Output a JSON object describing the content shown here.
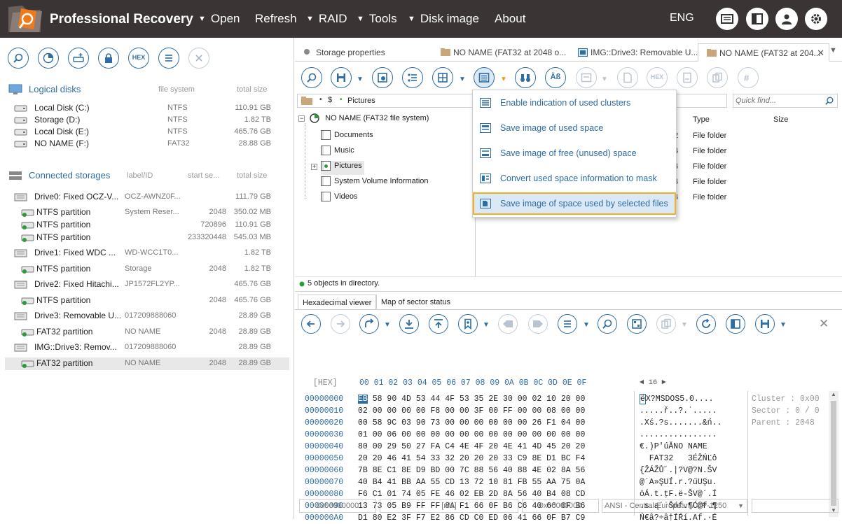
{
  "app": {
    "title": "Professional Recovery",
    "menu": [
      {
        "label": "Open",
        "arrow": true
      },
      {
        "label": "Refresh",
        "arrow": false
      },
      {
        "label": "RAID",
        "arrow": true
      },
      {
        "label": "Tools",
        "arrow": true
      },
      {
        "label": "Disk image",
        "arrow": true
      },
      {
        "label": "About",
        "arrow": false
      }
    ],
    "language": "ENG",
    "colors": {
      "titlebar": "#3a3434",
      "accent": "#2e6da4",
      "highlight_border": "#f0b020"
    }
  },
  "left_toolbar": {
    "hex_label": "HEX",
    "icons": [
      "search-icon",
      "partition-search-icon",
      "drive-add-icon",
      "lock-icon",
      "hex-icon",
      "list-icon",
      "close-icon"
    ]
  },
  "logical": {
    "title": "Logical disks",
    "col_fs": "file system",
    "col_size": "total size",
    "rows": [
      {
        "name": "Local Disk (C:)",
        "fs": "NTFS",
        "size": "110.91 GB"
      },
      {
        "name": "Storage (D:)",
        "fs": "NTFS",
        "size": "1.82 TB"
      },
      {
        "name": "Local Disk (E:)",
        "fs": "NTFS",
        "size": "465.76 GB"
      },
      {
        "name": "NO NAME (F:)",
        "fs": "FAT32",
        "size": "28.88 GB"
      }
    ]
  },
  "storages": {
    "title": "Connected storages",
    "col_label": "label/ID",
    "col_start": "start se...",
    "col_size": "total size",
    "rows": [
      {
        "name": "Drive0: Fixed OCZ-V...",
        "label": "OCZ-AWNZ0F...",
        "start": "",
        "size": "111.79 GB",
        "level": 0
      },
      {
        "name": "NTFS partition",
        "label": "System Reser...",
        "start": "2048",
        "size": "350.02 MB",
        "level": 1
      },
      {
        "name": "NTFS partition",
        "label": "",
        "start": "720896",
        "size": "110.91 GB",
        "level": 1
      },
      {
        "name": "NTFS partition",
        "label": "",
        "start": "233320448",
        "size": "545.03 MB",
        "level": 1
      },
      {
        "name": "Drive1: Fixed WDC ...",
        "label": "WD-WCC1T0...",
        "start": "",
        "size": "1.82 TB",
        "level": 0
      },
      {
        "name": "NTFS partition",
        "label": "Storage",
        "start": "2048",
        "size": "1.82 TB",
        "level": 1
      },
      {
        "name": "Drive2: Fixed Hitachi...",
        "label": "JP1572FL2YP...",
        "start": "",
        "size": "465.76 GB",
        "level": 0
      },
      {
        "name": "NTFS partition",
        "label": "",
        "start": "2048",
        "size": "465.76 GB",
        "level": 1
      },
      {
        "name": "Drive3: Removable U...",
        "label": "017209888060",
        "start": "",
        "size": "28.89 GB",
        "level": 0
      },
      {
        "name": "FAT32 partition",
        "label": "NO NAME",
        "start": "2048",
        "size": "28.89 GB",
        "level": 1
      },
      {
        "name": "IMG::Drive3: Remov...",
        "label": "017209888060",
        "start": "",
        "size": "28.89 GB",
        "level": 0
      },
      {
        "name": "FAT32 partition",
        "label": "NO NAME",
        "start": "2048",
        "size": "28.89 GB",
        "level": 1
      }
    ]
  },
  "tabs": [
    {
      "label": "Storage properties"
    },
    {
      "label": "NO NAME (FAT32 at 2048 o..."
    },
    {
      "label": "IMG::Drive3: Removable U..."
    },
    {
      "label": "NO NAME (FAT32 at 204..."
    }
  ],
  "toolbar": {
    "hex_label": "HEX"
  },
  "path": {
    "root": "$",
    "folder": "Pictures"
  },
  "find": {
    "placeholder": "Quick find..."
  },
  "tree": {
    "root": "NO NAME (FAT32 file system)",
    "items": [
      "Documents",
      "Music",
      "Pictures",
      "System Volume Information",
      "Videos"
    ]
  },
  "filelist": {
    "col_type": "Type",
    "col_size": "Size",
    "rows": [
      {
        "num": "2",
        "type": "File folder"
      },
      {
        "num": "4",
        "type": "File folder"
      },
      {
        "num": "4",
        "type": "File folder"
      },
      {
        "num": "4",
        "type": "File folder"
      },
      {
        "num": "4",
        "type": "File folder"
      }
    ]
  },
  "dropmenu": {
    "items": [
      "Enable indication of used clusters",
      "Save image of used space",
      "Save image of free (unused) space",
      "Convert used space information to mask",
      "Save image of space used by selected files"
    ]
  },
  "status": {
    "text": "5 objects in directory."
  },
  "hextabs": [
    "Hexadecimal viewer",
    "Map of sector status"
  ],
  "hex": {
    "header_label": "[HEX]",
    "header_cols": "00 01 02 03 04 05 06 07 08 09 0A 0B 0C 0D 0E 0F",
    "width_label": "◄ 16 ►",
    "addresses": [
      "00000000",
      "00000010",
      "00000020",
      "00000030",
      "00000040",
      "00000050",
      "00000060",
      "00000070",
      "00000080",
      "00000090",
      "000000A0"
    ],
    "first_byte": "EB",
    "first_rest": " 58 90 4D 53 44 4F 53 35 2E 30 00 02 10 20 00",
    "bytes": [
      "02 00 00 00 00 F8 00 00 3F 00 FF 00 00 08 00 00",
      "00 58 9C 03 90 73 00 00 00 00 00 00 26 F1 04 00",
      "01 00 06 00 00 00 00 00 00 00 00 00 00 00 00 00",
      "80 00 29 50 27 FA C4 4E 4F 20 4E 41 4D 45 20 20",
      "20 20 46 41 54 33 32 20 20 20 33 C9 8E D1 BC F4",
      "7B 8E C1 8E D9 BD 00 7C 88 56 40 88 4E 02 8A 56",
      "40 B4 41 BB AA 55 CD 13 72 10 81 FB 55 AA 75 0A",
      "F6 C1 01 74 05 FE 46 02 EB 2D 8A 56 40 B4 08 CD",
      "13 73 05 B9 FF FF 8A F1 66 0F B6 C6 40 66 0F B6",
      "D1 80 E2 3F F7 E2 86 CD C0 ED 06 41 66 0F B7 C9"
    ],
    "ascii_first_char": "ë",
    "ascii_first_rest": "X?MSDOS5.0....",
    "ascii": [
      ".....ř..?.˙.....",
      ".Xś.?s.......&ń..",
      "................",
      "€.)P'úĂNO NAME",
      "  FAT32   3ÉŽŃĽô",
      "{ŽÁŽŮ˝.|?V@?N.ŠV",
      "@´A»ŞUÍ.r.?űUŞu.",
      "öÁ.t.ţF.ë-ŠV@´.Í",
      ".s.ą˙˙Šńf.¶Ć@f.¶",
      "Ń€â?÷â†ÍŔí.Af.·É"
    ],
    "info": [
      "Cluster : 0x00",
      "Sector : 0 / 0",
      "Parent : 2048"
    ]
  },
  "statusbar": {
    "offset": "0x00000000",
    "value": "[n/a]",
    "offset2": "0x00000000",
    "encoding": "ANSI - Central European / CP-1250"
  }
}
